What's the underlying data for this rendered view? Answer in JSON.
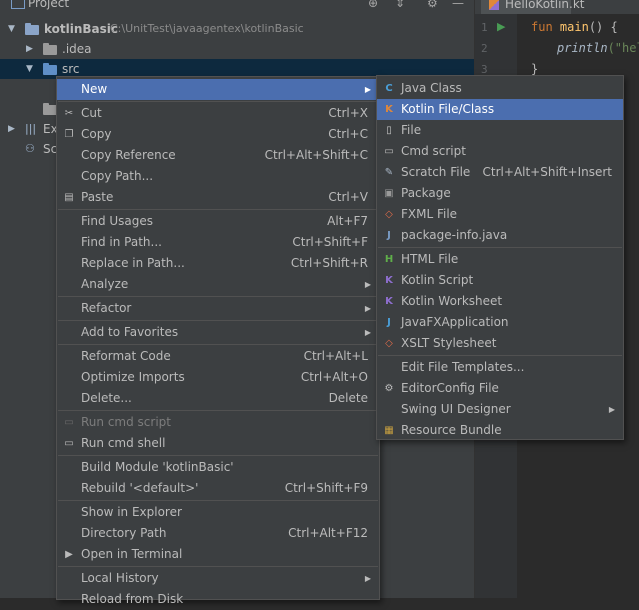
{
  "project_header": {
    "title": "Project"
  },
  "editor": {
    "tab_label": "HelloKotlin.kt",
    "line_numbers": [
      "1",
      "2",
      "3"
    ],
    "code": {
      "kw_fun": "fun",
      "fn_main": "main",
      "paren": "() {",
      "call": "println",
      "str": "(\"hel",
      "close": "}"
    }
  },
  "tree": {
    "root_name": "kotlinBasic",
    "root_path": "C:\\UnitTest\\javaagentex\\kotlinBasic",
    "idea": ".idea",
    "src": "src",
    "ext_partial": "Ex",
    "sc_partial": "Sc"
  },
  "context_menu": [
    {
      "label": "New",
      "selected": true,
      "submenu": true
    },
    {
      "sep": true
    },
    {
      "label": "Cut",
      "shortcut": "Ctrl+X",
      "icon": "scissors-icon"
    },
    {
      "label": "Copy",
      "shortcut": "Ctrl+C",
      "icon": "copy-icon"
    },
    {
      "label": "Copy Reference",
      "shortcut": "Ctrl+Alt+Shift+C"
    },
    {
      "label": "Copy Path...",
      "shortcut": ""
    },
    {
      "label": "Paste",
      "shortcut": "Ctrl+V",
      "icon": "paste-icon"
    },
    {
      "sep": true
    },
    {
      "label": "Find Usages",
      "shortcut": "Alt+F7"
    },
    {
      "label": "Find in Path...",
      "shortcut": "Ctrl+Shift+F"
    },
    {
      "label": "Replace in Path...",
      "shortcut": "Ctrl+Shift+R"
    },
    {
      "label": "Analyze",
      "submenu": true
    },
    {
      "sep": true
    },
    {
      "label": "Refactor",
      "submenu": true
    },
    {
      "sep": true
    },
    {
      "label": "Add to Favorites",
      "submenu": true
    },
    {
      "sep": true
    },
    {
      "label": "Reformat Code",
      "shortcut": "Ctrl+Alt+L"
    },
    {
      "label": "Optimize Imports",
      "shortcut": "Ctrl+Alt+O"
    },
    {
      "label": "Delete...",
      "shortcut": "Delete"
    },
    {
      "sep": true
    },
    {
      "label": "Run cmd script",
      "disabled": true,
      "icon": "cmd-icon"
    },
    {
      "label": "Run cmd shell",
      "icon": "cmd-icon"
    },
    {
      "sep": true
    },
    {
      "label": "Build Module 'kotlinBasic'"
    },
    {
      "label": "Rebuild '<default>'",
      "shortcut": "Ctrl+Shift+F9"
    },
    {
      "sep": true
    },
    {
      "label": "Show in Explorer"
    },
    {
      "label": "Directory Path",
      "shortcut": "Ctrl+Alt+F12"
    },
    {
      "label": "Open in Terminal",
      "icon": "terminal-icon"
    },
    {
      "sep": true
    },
    {
      "label": "Local History",
      "submenu": true
    },
    {
      "label": "Reload from Disk"
    }
  ],
  "new_submenu": [
    {
      "label": "Java Class",
      "icon": "java-class-icon"
    },
    {
      "label": "Kotlin File/Class",
      "selected": true,
      "icon": "kotlin-file-icon"
    },
    {
      "label": "File",
      "icon": "file-icon"
    },
    {
      "label": "Cmd script",
      "icon": "cmd-icon"
    },
    {
      "label": "Scratch File",
      "shortcut": "Ctrl+Alt+Shift+Insert",
      "icon": "scratch-file-icon"
    },
    {
      "label": "Package",
      "icon": "package-icon"
    },
    {
      "label": "FXML File",
      "icon": "fxml-icon"
    },
    {
      "label": "package-info.java",
      "icon": "package-info-icon"
    },
    {
      "sep": true
    },
    {
      "label": "HTML File",
      "icon": "html-icon"
    },
    {
      "label": "Kotlin Script",
      "icon": "kotlin-script-icon"
    },
    {
      "label": "Kotlin Worksheet",
      "icon": "kotlin-worksheet-icon"
    },
    {
      "label": "JavaFXApplication",
      "icon": "javafx-icon"
    },
    {
      "label": "XSLT Stylesheet",
      "icon": "xslt-icon"
    },
    {
      "sep": true
    },
    {
      "label": "Edit File Templates..."
    },
    {
      "label": "EditorConfig File",
      "icon": "gear-icon"
    },
    {
      "label": "Swing UI Designer",
      "submenu": true
    },
    {
      "label": "Resource Bundle",
      "icon": "resource-bundle-icon"
    }
  ],
  "colors": {
    "selection": "#4b6eaf",
    "menu_bg": "#3c3f41",
    "editor_bg": "#2b2b2b"
  }
}
